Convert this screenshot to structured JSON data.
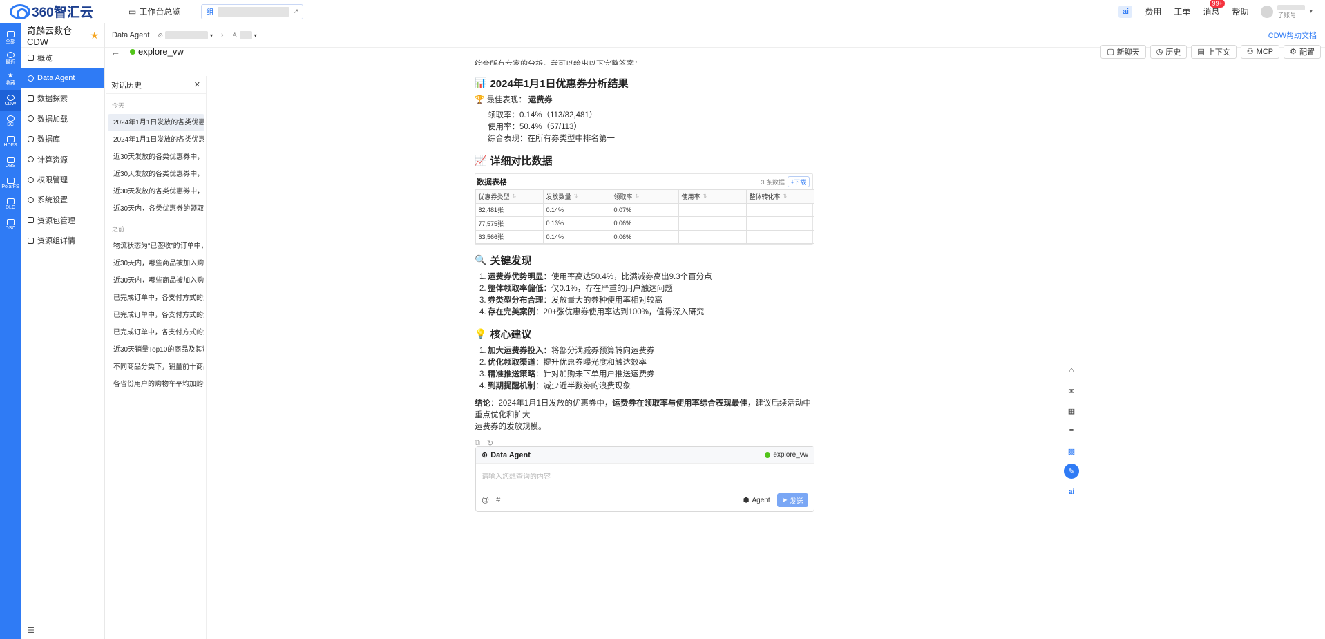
{
  "topbar": {
    "brand": "360智汇云",
    "workbench": "工作台总览",
    "group_tag": "组",
    "fees": "费用",
    "tickets": "工单",
    "messages": "消息",
    "message_count": "99+",
    "help": "帮助",
    "ai_label": "ai",
    "sub_account": "子账号"
  },
  "rail": {
    "items": [
      "全部",
      "最近",
      "收藏",
      "CDW",
      "SC",
      "HDFS",
      "OBS",
      "PolarFS",
      "DLC",
      "DSC"
    ]
  },
  "sidebar": {
    "title": "奇麟云数仓 CDW",
    "items": [
      {
        "label": "概览"
      },
      {
        "label": "Data Agent"
      },
      {
        "label": "数据探索"
      },
      {
        "label": "数据加载"
      },
      {
        "label": "数据库"
      },
      {
        "label": "计算资源"
      },
      {
        "label": "权限管理"
      },
      {
        "label": "系统设置"
      },
      {
        "label": "资源包管理"
      },
      {
        "label": "资源组详情"
      }
    ]
  },
  "breadcrumb": {
    "root": "Data Agent",
    "help_link": "CDW帮助文档"
  },
  "header": {
    "datasource": "explore_vw",
    "buttons": {
      "new_chat": "新聊天",
      "history": "历史",
      "context": "上下文",
      "mcp": "MCP",
      "config": "配置"
    }
  },
  "history": {
    "title": "对话历史",
    "today_label": "今天",
    "earlier_label": "之前",
    "today": [
      "2024年1月1日发放的各类优惠券",
      "2024年1月1日发放的各类优惠券中",
      "近30天发放的各类优惠券中，哪种",
      "近30天发放的各类优惠券中，哪种",
      "近30天发放的各类优惠券中，哪种",
      "近30天内，各类优惠券的领取量与"
    ],
    "earlier": [
      "物流状态为“已签收”的订单中，收",
      "近30天内，哪些商品被加入购物车",
      "近30天内，哪些商品被加入购物车",
      "已完成订单中，各支付方式的金额",
      "已完成订单中，各支付方式的金额",
      "已完成订单中，各支付方式的金额",
      "近30天销量Top10的商品及其贡献",
      "不同商品分类下，销量前十商品的",
      "各省份用户的购物车平均加购件数"
    ]
  },
  "answer": {
    "intro_cut": "综合所有专家的分析，我可以给出以下完整答案：",
    "result_title": "2024年1月1日优惠券分析结果",
    "best_label": "最佳表现：",
    "best_value": "运费券",
    "metrics": [
      {
        "label": "领取率：",
        "value": "0.14%（113/82,481）"
      },
      {
        "label": "使用率：",
        "value": "50.4%（57/113）"
      },
      {
        "label": "综合表现：",
        "value": "在所有券类型中排名第一"
      }
    ],
    "detail_title": "详细对比数据",
    "table": {
      "title": "数据表格",
      "count": "3 条数据",
      "download": "下载",
      "headers": [
        "优惠券类型",
        "发放数量",
        "领取率",
        "使用率",
        "整体转化率"
      ],
      "rows": [
        [
          "82,481张",
          "0.14%",
          "0.07%",
          "",
          ""
        ],
        [
          "77,575张",
          "0.13%",
          "0.06%",
          "",
          ""
        ],
        [
          "63,566张",
          "0.14%",
          "0.06%",
          "",
          ""
        ]
      ]
    },
    "findings_title": "关键发现",
    "findings": [
      {
        "b": "运费券优势明显",
        "t": "：使用率高达50.4%，比满减券高出9.3个百分点"
      },
      {
        "b": "整体领取率偏低",
        "t": "：仅0.1%，存在严重的用户触达问题"
      },
      {
        "b": "券类型分布合理",
        "t": "：发放量大的券种使用率相对较高"
      },
      {
        "b": "存在完美案例",
        "t": "：20+张优惠券使用率达到100%，值得深入研究"
      }
    ],
    "advice_title": "核心建议",
    "advice": [
      {
        "b": "加大运费券投入",
        "t": "：将部分满减券预算转向运费券"
      },
      {
        "b": "优化领取渠道",
        "t": "：提升优惠券曝光度和触达效率"
      },
      {
        "b": "精准推送策略",
        "t": "：针对加购未下单用户推送运费券"
      },
      {
        "b": "到期提醒机制",
        "t": "：减少近半数券的浪费现象"
      }
    ],
    "conclusion_label": "结论",
    "conclusion_a": "：2024年1月1日发放的优惠券中，",
    "conclusion_b": "运费券在领取率与使用率综合表现最佳",
    "conclusion_c": "，建议后续活动中重点优化和扩大",
    "conclusion_d": "运费券的发放规模。"
  },
  "input": {
    "agent_title": "Data Agent",
    "datasource": "explore_vw",
    "placeholder": "请输入您想查询的内容",
    "at": "@",
    "hash": "#",
    "mode": "Agent",
    "send": "发送"
  },
  "colors": {
    "brand": "#2f7bf5",
    "online": "#52c41a",
    "badge": "#f5313d",
    "star": "#f5a623"
  }
}
